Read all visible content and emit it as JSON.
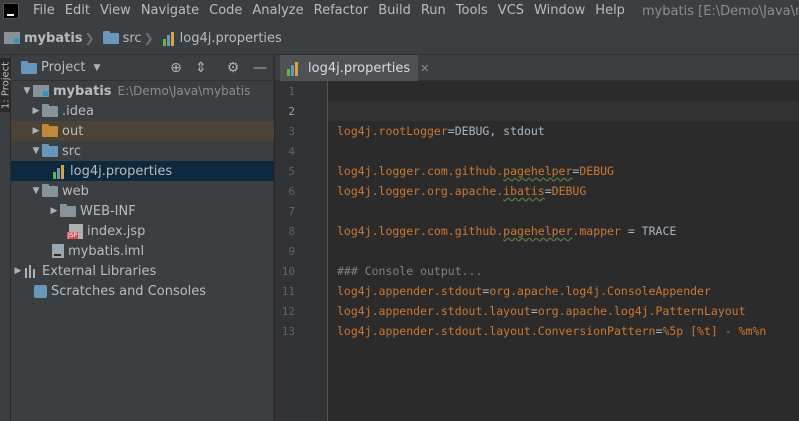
{
  "menubar": {
    "items": [
      "File",
      "Edit",
      "View",
      "Navigate",
      "Code",
      "Analyze",
      "Refactor",
      "Build",
      "Run",
      "Tools",
      "VCS",
      "Window",
      "Help"
    ],
    "window_title": "mybatis [E:\\Demo\\Java\\myba"
  },
  "navbar": {
    "crumbs": [
      "mybatis",
      "src",
      "log4j.properties"
    ]
  },
  "toolstrip": {
    "label": "1: Project"
  },
  "project": {
    "title": "Project",
    "tree": [
      {
        "label": "mybatis",
        "path": "E:\\Demo\\Java\\mybatis"
      },
      {
        "label": ".idea"
      },
      {
        "label": "out"
      },
      {
        "label": "src"
      },
      {
        "label": "log4j.properties"
      },
      {
        "label": "web"
      },
      {
        "label": "WEB-INF"
      },
      {
        "label": "index.jsp"
      },
      {
        "label": "mybatis.iml"
      },
      {
        "label": "External Libraries"
      },
      {
        "label": "Scratches and Consoles"
      }
    ]
  },
  "editor": {
    "tab_label": "log4j.properties",
    "line_numbers": [
      "1",
      "2",
      "3",
      "4",
      "5",
      "6",
      "7",
      "8",
      "9",
      "10",
      "11",
      "12",
      "13"
    ],
    "lines": {
      "l3_key": "log4j.rootLogger",
      "l3_eq": "=",
      "l3_val": "DEBUG, stdout",
      "l5_key_a": "log4j.logger.com.github.",
      "l5_key_b": "pagehelper",
      "l5_eq": "=",
      "l5_val": "DEBUG",
      "l6_key_a": "log4j.logger.org.apache.",
      "l6_key_b": "ibatis",
      "l6_eq": "=",
      "l6_val": "DEBUG",
      "l8_key_a": "log4j.logger.com.github.",
      "l8_key_b": "pagehelper",
      "l8_key_c": ".mapper",
      "l8_eq": " = ",
      "l8_val": "TRACE",
      "l10_comment": "### Console output...",
      "l11_key": "log4j.appender.stdout",
      "l11_eq": "=",
      "l11_val": "org.apache.log4j.ConsoleAppender",
      "l12_key": "log4j.appender.stdout.layout",
      "l12_eq": "=",
      "l12_val": "org.apache.log4j.PatternLayout",
      "l13_key": "log4j.appender.stdout.layout.ConversionPattern",
      "l13_eq": "=",
      "l13_val": "%5p [%t] - %m%n"
    }
  }
}
